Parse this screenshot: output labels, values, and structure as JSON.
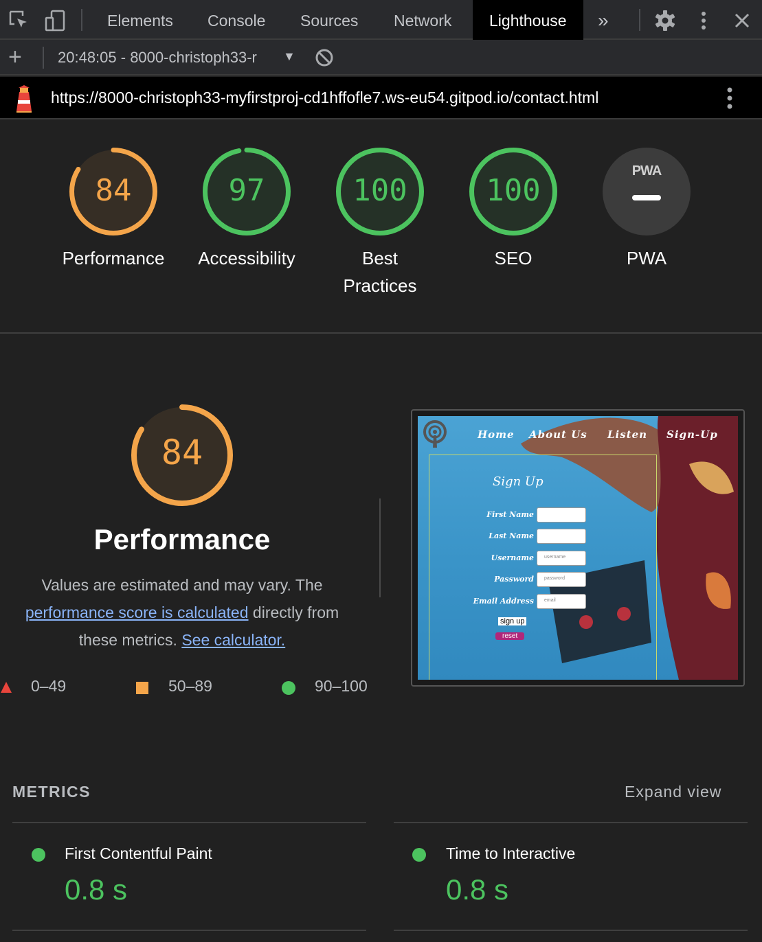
{
  "tabs": {
    "items": [
      "Elements",
      "Console",
      "Sources",
      "Network",
      "Lighthouse"
    ],
    "more": "»"
  },
  "toolbar": {
    "add": "+",
    "report": "20:48:05 - 8000-christoph33-r",
    "caret": "▼"
  },
  "urlbar": {
    "url": "https://8000-christoph33-myfirstproj-cd1hffofle7.ws-eu54.gitpod.io/contact.html"
  },
  "categories": [
    {
      "label": "Performance",
      "score": "84",
      "value": 0.84,
      "status": "average"
    },
    {
      "label": "Accessibility",
      "score": "97",
      "value": 0.97,
      "status": "pass"
    },
    {
      "label": "Best Practices",
      "score": "100",
      "value": 1.0,
      "status": "pass"
    },
    {
      "label": "SEO",
      "score": "100",
      "value": 1.0,
      "status": "pass"
    },
    {
      "label": "PWA",
      "score": "",
      "value": null,
      "status": "na",
      "badge": "PWA"
    }
  ],
  "performance": {
    "score": "84",
    "value": 0.84,
    "title": "Performance",
    "desc_1": "Values are estimated and may vary. The ",
    "desc_link1": "performance score is calculated",
    "desc_2": " directly from these metrics. ",
    "desc_link2": "See calculator."
  },
  "legend": [
    {
      "range": "0–49",
      "shape": "triangle"
    },
    {
      "range": "50–89",
      "shape": "square"
    },
    {
      "range": "90–100",
      "shape": "circle"
    }
  ],
  "screenshot": {
    "nav": [
      "Home",
      "About Us",
      "Listen",
      "Sign-Up"
    ],
    "heading": "Sign Up",
    "fields": [
      {
        "label": "First Name",
        "placeholder": ""
      },
      {
        "label": "Last Name",
        "placeholder": ""
      },
      {
        "label": "Username",
        "placeholder": "username"
      },
      {
        "label": "Password",
        "placeholder": "password"
      },
      {
        "label": "Email Address",
        "placeholder": "email"
      }
    ],
    "submit": "sign up",
    "reset": "reset"
  },
  "metrics": {
    "heading": "METRICS",
    "expand": "Expand view",
    "items": [
      {
        "title": "First Contentful Paint",
        "value": "0.8 s"
      },
      {
        "title": "Time to Interactive",
        "value": "0.8 s"
      }
    ]
  },
  "colors": {
    "pass": "#4cc35f",
    "average": "#f4a54a",
    "fail": "#e8453c",
    "na": "#3c3c3c"
  }
}
